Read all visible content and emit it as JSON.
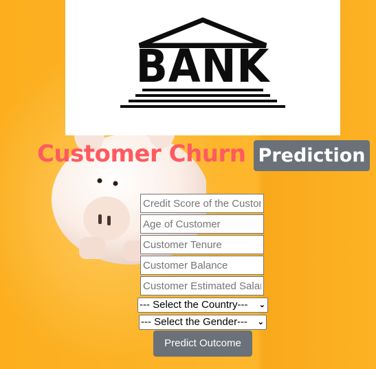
{
  "logo": {
    "text": "BANK"
  },
  "header": {
    "title": "Customer Churn",
    "badge": "Prediction"
  },
  "form": {
    "credit_score_placeholder": "Credit Score of the Customer",
    "age_placeholder": "Age of Customer",
    "tenure_placeholder": "Customer Tenure",
    "balance_placeholder": "Customer Balance",
    "salary_placeholder": "Customer Estimated Salary",
    "country_select": "--- Select the Country---",
    "gender_select": "--- Select the Gender---",
    "submit_label": "Predict Outcome"
  },
  "colors": {
    "background": "#fdb62b",
    "title": "#ff5a5f",
    "button": "#6b7178"
  },
  "icons": {
    "logo": "bank-building-icon",
    "dropdown": "chevron-down-icon"
  }
}
